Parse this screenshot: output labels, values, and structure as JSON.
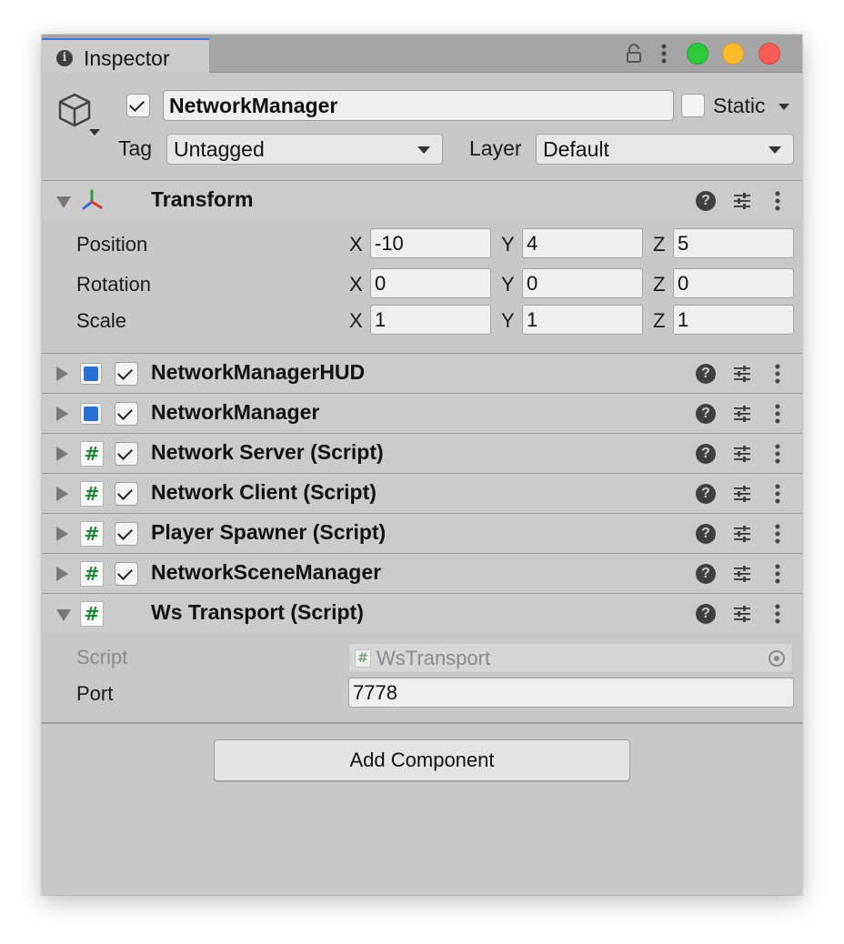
{
  "window": {
    "tab_title": "Inspector",
    "tab_icon": "info-icon",
    "tab_info_glyph": "i",
    "title_controls": [
      "lock-icon",
      "kebab-menu-icon"
    ],
    "traffic_lights": {
      "green": "#2dc93c",
      "yellow": "#fdbc2c",
      "red": "#fd5d56"
    },
    "accent": "#3a79d8"
  },
  "gameobject": {
    "icon": "cube-icon",
    "active": true,
    "name": "NetworkManager",
    "static": false,
    "static_label": "Static",
    "tag_label": "Tag",
    "tag_value": "Untagged",
    "layer_label": "Layer",
    "layer_value": "Default"
  },
  "transform": {
    "title": "Transform",
    "expanded": true,
    "rows": [
      {
        "label": "Position",
        "x": "-10",
        "y": "4",
        "z": "5"
      },
      {
        "label": "Rotation",
        "x": "0",
        "y": "0",
        "z": "0"
      },
      {
        "label": "Scale",
        "x": "1",
        "y": "1",
        "z": "1"
      }
    ],
    "axis_labels": {
      "x": "X",
      "y": "Y",
      "z": "Z"
    }
  },
  "components": [
    {
      "title": "NetworkManagerHUD",
      "icon": "network-component-icon",
      "enabled": true,
      "expanded": false
    },
    {
      "title": "NetworkManager",
      "icon": "network-component-icon",
      "enabled": true,
      "expanded": false
    },
    {
      "title": "Network Server (Script)",
      "icon": "script-hash-icon",
      "enabled": true,
      "expanded": false
    },
    {
      "title": "Network Client (Script)",
      "icon": "script-hash-icon",
      "enabled": true,
      "expanded": false
    },
    {
      "title": "Player Spawner (Script)",
      "icon": "script-hash-icon",
      "enabled": true,
      "expanded": false
    },
    {
      "title": "NetworkSceneManager",
      "icon": "script-hash-icon",
      "enabled": true,
      "expanded": false
    },
    {
      "title": "Ws Transport (Script)",
      "icon": "script-hash-icon",
      "enabled": null,
      "expanded": true
    }
  ],
  "ws_transport": {
    "script_label": "Script",
    "script_value": "WsTransport",
    "port_label": "Port",
    "port_value": "7778"
  },
  "header_icons": {
    "help": "?",
    "help_icon": "help-icon",
    "preset": "preset-sliders-icon",
    "menu": "kebab-menu-icon"
  },
  "hash_glyph": "#",
  "add_component_label": "Add Component"
}
